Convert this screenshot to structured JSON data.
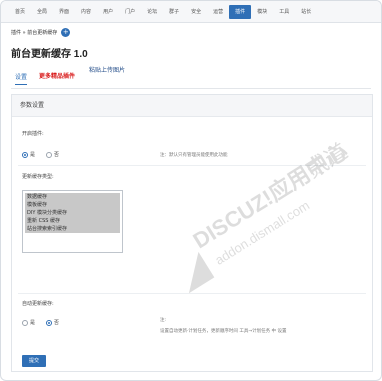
{
  "nav": [
    "首页",
    "全局",
    "界面",
    "内容",
    "用户",
    "门户",
    "论坛",
    "群子",
    "安全",
    "运营",
    "插件",
    "模块",
    "工具",
    "站长"
  ],
  "nav_active_index": 10,
  "breadcrumb": "插件 » 前台更新缓存",
  "breadcrumb_add": "+",
  "title": "前台更新缓存 1.0",
  "tabs": {
    "settings": "设置",
    "more": "更多精品插件",
    "paste": "粘贴上传图片"
  },
  "panel": {
    "heading": "参数设置",
    "enable": {
      "label": "开启插件:",
      "options": [
        "是",
        "否"
      ],
      "selected": "是",
      "hint": "注：默认只有管理员能使用此功能"
    },
    "types": {
      "label": "更新缓存类型:",
      "options": [
        "数据缓存",
        "模板缓存",
        "DIY 模块分类缓存",
        "重新 CSS 缓存",
        "站台搜索索引缓存"
      ]
    },
    "auto": {
      "label": "自动更新缓存:",
      "options": [
        "是",
        "否"
      ],
      "selected": "否",
      "hint1": "注:",
      "hint2": "设置自动更新·计划任务，更新顺序时间 工具→计划任务 中 设置"
    },
    "submit": "提交"
  },
  "watermark": {
    "text1": "DISCUZ!应用中心",
    "text2": "addon.dismall.com",
    "text3": "贰道"
  }
}
